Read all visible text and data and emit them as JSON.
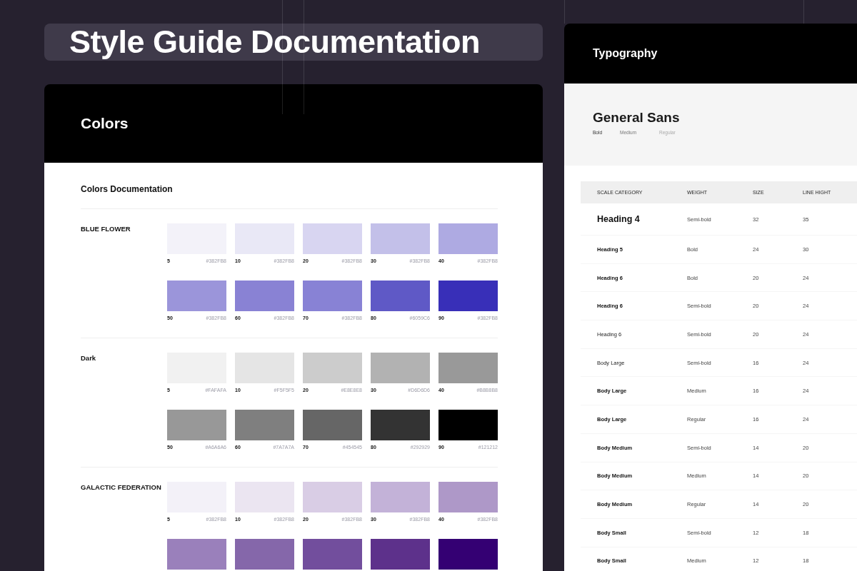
{
  "banner": {
    "title": "Style Guide Documentation"
  },
  "colors_card": {
    "title": "Colors",
    "subtitle": "Colors Documentation",
    "palettes": [
      {
        "name": "BLUE  FLOWER",
        "rows": [
          [
            {
              "step": "5",
              "hex": "#382FB8",
              "color": "#f3f2f9"
            },
            {
              "step": "10",
              "hex": "#382FB8",
              "color": "#e9e8f6"
            },
            {
              "step": "20",
              "hex": "#382FB8",
              "color": "#d8d5f1"
            },
            {
              "step": "30",
              "hex": "#382FB8",
              "color": "#c3c0e9"
            },
            {
              "step": "40",
              "hex": "#382FB8",
              "color": "#aeaae2"
            }
          ],
          [
            {
              "step": "50",
              "hex": "#382FB8",
              "color": "#9b95da"
            },
            {
              "step": "60",
              "hex": "#382FB8",
              "color": "#8982d4"
            },
            {
              "step": "70",
              "hex": "#382FB8",
              "color": "#8882d5"
            },
            {
              "step": "80",
              "hex": "#6059C6",
              "color": "#5f59c6"
            },
            {
              "step": "90",
              "hex": "#382FB8",
              "color": "#382fb8"
            }
          ]
        ]
      },
      {
        "name": "Dark",
        "rows": [
          [
            {
              "step": "5",
              "hex": "#FAFAFA",
              "color": "#f1f1f1"
            },
            {
              "step": "10",
              "hex": "#F5F5F5",
              "color": "#e5e5e5"
            },
            {
              "step": "20",
              "hex": "#E8E8E8",
              "color": "#cccccc"
            },
            {
              "step": "30",
              "hex": "#D6D6D6",
              "color": "#b2b2b2"
            },
            {
              "step": "40",
              "hex": "#B8B8B8",
              "color": "#999999"
            }
          ],
          [
            {
              "step": "50",
              "hex": "#A6A6A6",
              "color": "#989898"
            },
            {
              "step": "60",
              "hex": "#7A7A7A",
              "color": "#7f7f7f"
            },
            {
              "step": "70",
              "hex": "#454545",
              "color": "#666666"
            },
            {
              "step": "80",
              "hex": "#292929",
              "color": "#333333"
            },
            {
              "step": "90",
              "hex": "#121212",
              "color": "#000000"
            }
          ]
        ]
      },
      {
        "name": "GALACTIC FEDERATION",
        "rows": [
          [
            {
              "step": "5",
              "hex": "#382FB8",
              "color": "#f3f1f8"
            },
            {
              "step": "10",
              "hex": "#382FB8",
              "color": "#ebe5f1"
            },
            {
              "step": "20",
              "hex": "#382FB8",
              "color": "#d9cde5"
            },
            {
              "step": "30",
              "hex": "#382FB8",
              "color": "#c3b2d8"
            },
            {
              "step": "40",
              "hex": "#382FB8",
              "color": "#ae98c8"
            }
          ],
          [
            {
              "color": "#9a80bb"
            },
            {
              "color": "#8567aa"
            },
            {
              "color": "#724e9d"
            },
            {
              "color": "#5d318b"
            },
            {
              "color": "#340073"
            }
          ]
        ]
      }
    ]
  },
  "typography_card": {
    "title": "Typography",
    "font_name": "General Sans",
    "weights": [
      "Bold",
      "Medium",
      "Regular"
    ],
    "table": {
      "columns": [
        "SCALE CATEGORY",
        "WEIGHT",
        "SIZE",
        "LINE HIGHT"
      ],
      "rows": [
        {
          "kind": "large",
          "cells": [
            "Heading 4",
            "Semi-bold",
            "32",
            "35"
          ]
        },
        {
          "kind": "bold",
          "cells": [
            "Heading 5",
            "Bold",
            "24",
            "30"
          ]
        },
        {
          "kind": "bold",
          "cells": [
            "Heading 6",
            "Bold",
            "20",
            "24"
          ]
        },
        {
          "kind": "bold",
          "cells": [
            "Heading 6",
            "Semi-bold",
            "20",
            "24"
          ]
        },
        {
          "kind": "plain",
          "cells": [
            "Heading 6",
            "Semi-bold",
            "20",
            "24"
          ]
        },
        {
          "kind": "plain",
          "cells": [
            "Body Large",
            "Semi-bold",
            "16",
            "24"
          ]
        },
        {
          "kind": "bold",
          "cells": [
            "Body Large",
            "Medium",
            "16",
            "24"
          ]
        },
        {
          "kind": "bold",
          "cells": [
            "Body Large",
            "Regular",
            "16",
            "24"
          ]
        },
        {
          "kind": "bold",
          "cells": [
            "Body Medium",
            "Semi-bold",
            "14",
            "20"
          ]
        },
        {
          "kind": "bold",
          "cells": [
            "Body Medium",
            "Medium",
            "14",
            "20"
          ]
        },
        {
          "kind": "bold",
          "cells": [
            "Body Medium",
            "Regular",
            "14",
            "20"
          ]
        },
        {
          "kind": "bold",
          "cells": [
            "Body Small",
            "Semi-bold",
            "12",
            "18"
          ]
        },
        {
          "kind": "bold",
          "cells": [
            "Body Small",
            "Medium",
            "12",
            "18"
          ]
        }
      ]
    }
  }
}
